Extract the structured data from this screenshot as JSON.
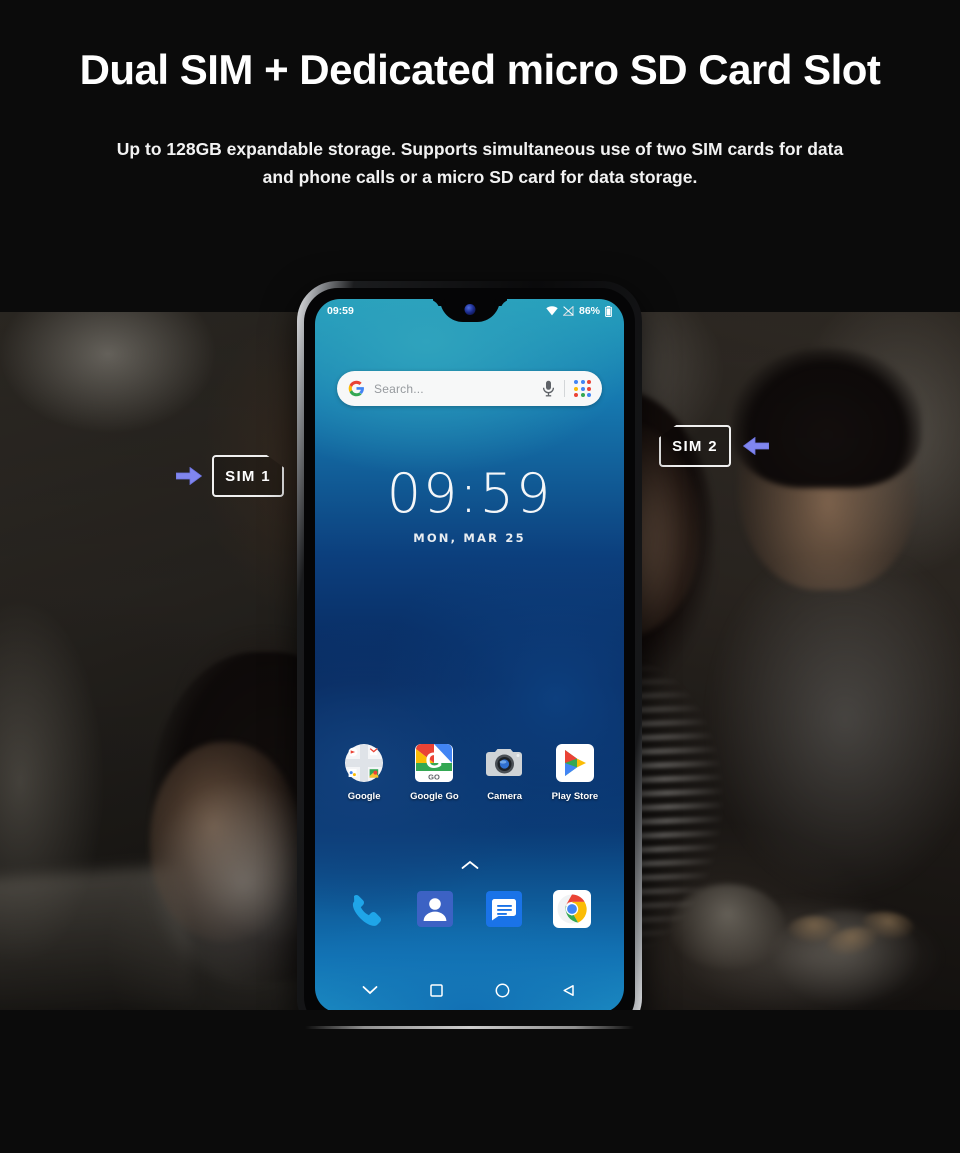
{
  "header": {
    "headline": "Dual SIM + Dedicated micro SD Card Slot",
    "subhead_line1": "Up to 128GB expandable storage. Supports simultaneous use of two SIM cards for data",
    "subhead_line2": "and phone calls or a micro SD card for data storage."
  },
  "callouts": {
    "sim1": {
      "label": "SIM  1",
      "arrow_direction": "right",
      "arrow_color": "#8086ef"
    },
    "sim2": {
      "label": "SIM  2",
      "arrow_direction": "left",
      "arrow_color": "#8086ef"
    }
  },
  "phone": {
    "status_bar": {
      "time": "09:59",
      "wifi_icon": "wifi-icon",
      "signal_icon": "signal-off-icon",
      "battery_percent": "86%",
      "battery_icon": "battery-icon"
    },
    "search": {
      "logo_icon": "google-g-icon",
      "placeholder": "Search...",
      "mic_icon": "microphone-icon",
      "apps_icon": "google-apps-dots-icon"
    },
    "clock": {
      "time": "09:59",
      "date": "MON, MAR 25"
    },
    "apps": [
      {
        "label": "Google",
        "icon": "google-folder-icon"
      },
      {
        "label": "Google Go",
        "icon": "google-go-icon"
      },
      {
        "label": "Camera",
        "icon": "camera-icon"
      },
      {
        "label": "Play Store",
        "icon": "play-store-icon"
      }
    ],
    "drawer_handle_icon": "chevron-up-icon",
    "dock": [
      {
        "name": "phone-dialer",
        "icon": "phone-handset-icon"
      },
      {
        "name": "contacts",
        "icon": "contacts-person-icon"
      },
      {
        "name": "messages",
        "icon": "messages-bubble-icon"
      },
      {
        "name": "chrome",
        "icon": "chrome-icon"
      }
    ],
    "nav_bar": [
      {
        "name": "hide-navbar",
        "icon": "chevron-down-icon"
      },
      {
        "name": "recents",
        "icon": "square-icon"
      },
      {
        "name": "home",
        "icon": "circle-icon"
      },
      {
        "name": "back",
        "icon": "triangle-left-icon"
      }
    ]
  },
  "colors": {
    "background": "#0b0b0b",
    "headline_text": "#ffffff",
    "wallpaper_top": "#25a0bd",
    "wallpaper_mid": "#07265a",
    "wallpaper_bottom": "#1e93c6",
    "accent_arrow": "#8086ef"
  }
}
